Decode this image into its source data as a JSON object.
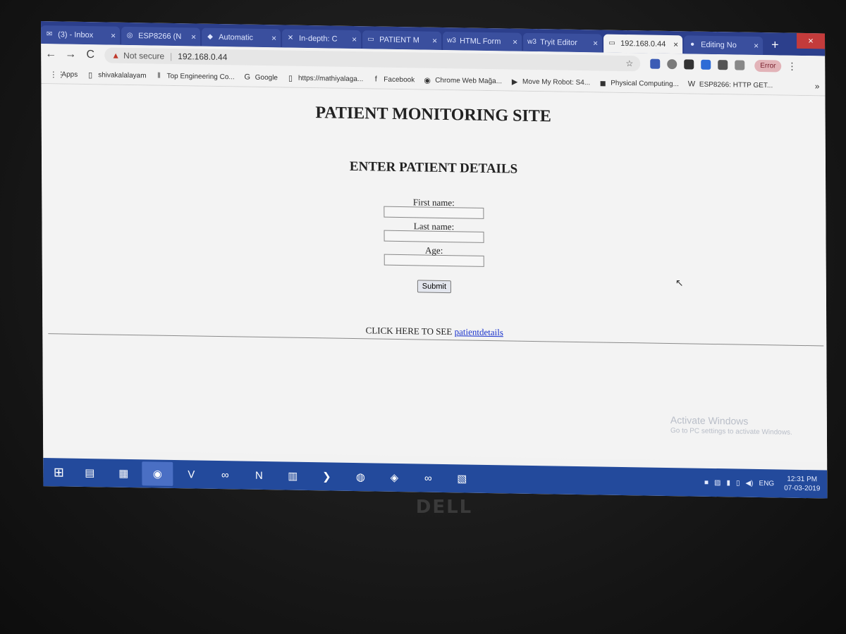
{
  "browser": {
    "tabs": [
      {
        "icon": "inbox-icon",
        "glyph": "✉",
        "label": "(3) - Inbox",
        "active": false
      },
      {
        "icon": "esp-icon",
        "glyph": "◎",
        "label": "ESP8266 (N",
        "active": false
      },
      {
        "icon": "diamond-icon",
        "glyph": "◆",
        "label": "Automatic",
        "active": false
      },
      {
        "icon": "article-icon",
        "glyph": "✕",
        "label": "In-depth: C",
        "active": false
      },
      {
        "icon": "page-icon",
        "glyph": "▭",
        "label": "PATIENT M",
        "active": false
      },
      {
        "icon": "w3-icon",
        "glyph": "w3",
        "label": "HTML Form",
        "active": false
      },
      {
        "icon": "w3-icon",
        "glyph": "w3",
        "label": "Tryit Editor",
        "active": false
      },
      {
        "icon": "page-icon",
        "glyph": "▭",
        "label": "192.168.0.44",
        "active": true
      },
      {
        "icon": "edit-icon",
        "glyph": "●",
        "label": "Editing No",
        "active": false
      }
    ],
    "new_tab": "+",
    "window_close": "×",
    "toolbar": {
      "back": "←",
      "forward": "→",
      "reload": "C",
      "security_warning": "▲",
      "not_secure": "Not secure",
      "separator": "|",
      "url": "192.168.0.44",
      "star": "☆",
      "error_badge": "Error",
      "menu": "⋮"
    },
    "bookmarks": [
      {
        "icon": "apps-icon",
        "glyph": "⋮⋮",
        "label": "Apps"
      },
      {
        "icon": "page-icon",
        "glyph": "▯",
        "label": "shivakalalayam"
      },
      {
        "icon": "bookmark-bars-icon",
        "glyph": "‖",
        "label": "Top Engineering Co..."
      },
      {
        "icon": "google-icon",
        "glyph": "G",
        "label": "Google"
      },
      {
        "icon": "page-icon",
        "glyph": "▯",
        "label": "https://mathiyalaga..."
      },
      {
        "icon": "facebook-icon",
        "glyph": "f",
        "label": "Facebook"
      },
      {
        "icon": "chrome-store-icon",
        "glyph": "◉",
        "label": "Chrome Web Mağa..."
      },
      {
        "icon": "youtube-icon",
        "glyph": "▶",
        "label": "Move My Robot: S4..."
      },
      {
        "icon": "computing-icon",
        "glyph": "◼",
        "label": "Physical Computing..."
      },
      {
        "icon": "wordpress-icon",
        "glyph": "W",
        "label": "ESP8266: HTTP GET..."
      }
    ],
    "bookmarks_more": "»"
  },
  "page": {
    "title": "PATIENT MONITORING SITE",
    "section_title": "ENTER PATIENT DETAILS",
    "form": {
      "first_name_label": "First name:",
      "first_name_value": "",
      "last_name_label": "Last name:",
      "last_name_value": "",
      "age_label": "Age:",
      "age_value": "",
      "submit_label": "Submit"
    },
    "click_text": "CLICK HERE TO SEE",
    "link_text": "patientdetails"
  },
  "os": {
    "activate_title": "Activate Windows",
    "activate_sub": "Go to PC settings to activate Windows.",
    "start": "⊞",
    "taskbar_apps": [
      {
        "icon": "file-explorer-icon",
        "glyph": "▤",
        "active": false
      },
      {
        "icon": "network-icon",
        "glyph": "▦",
        "active": false
      },
      {
        "icon": "chrome-icon",
        "glyph": "◉",
        "active": true
      },
      {
        "icon": "vs-icon",
        "glyph": "V",
        "active": false
      },
      {
        "icon": "arduino-icon",
        "glyph": "∞",
        "active": false
      },
      {
        "icon": "onenote-icon",
        "glyph": "N",
        "active": false
      },
      {
        "icon": "notepad-icon",
        "glyph": "▥",
        "active": false
      },
      {
        "icon": "vscode-icon",
        "glyph": "❯",
        "active": false
      },
      {
        "icon": "app-icon",
        "glyph": "◍",
        "active": false
      },
      {
        "icon": "python-icon",
        "glyph": "◈",
        "active": false
      },
      {
        "icon": "arduino-icon",
        "glyph": "∞",
        "active": false
      },
      {
        "icon": "image-icon",
        "glyph": "▧",
        "active": false
      }
    ],
    "tray": {
      "lang": "ENG",
      "time": "12:31 PM",
      "date": "07-03-2019"
    }
  },
  "colors": {
    "tabstrip": "#2c3f8c",
    "taskbar": "#234a9c",
    "link": "#1a33cc"
  }
}
